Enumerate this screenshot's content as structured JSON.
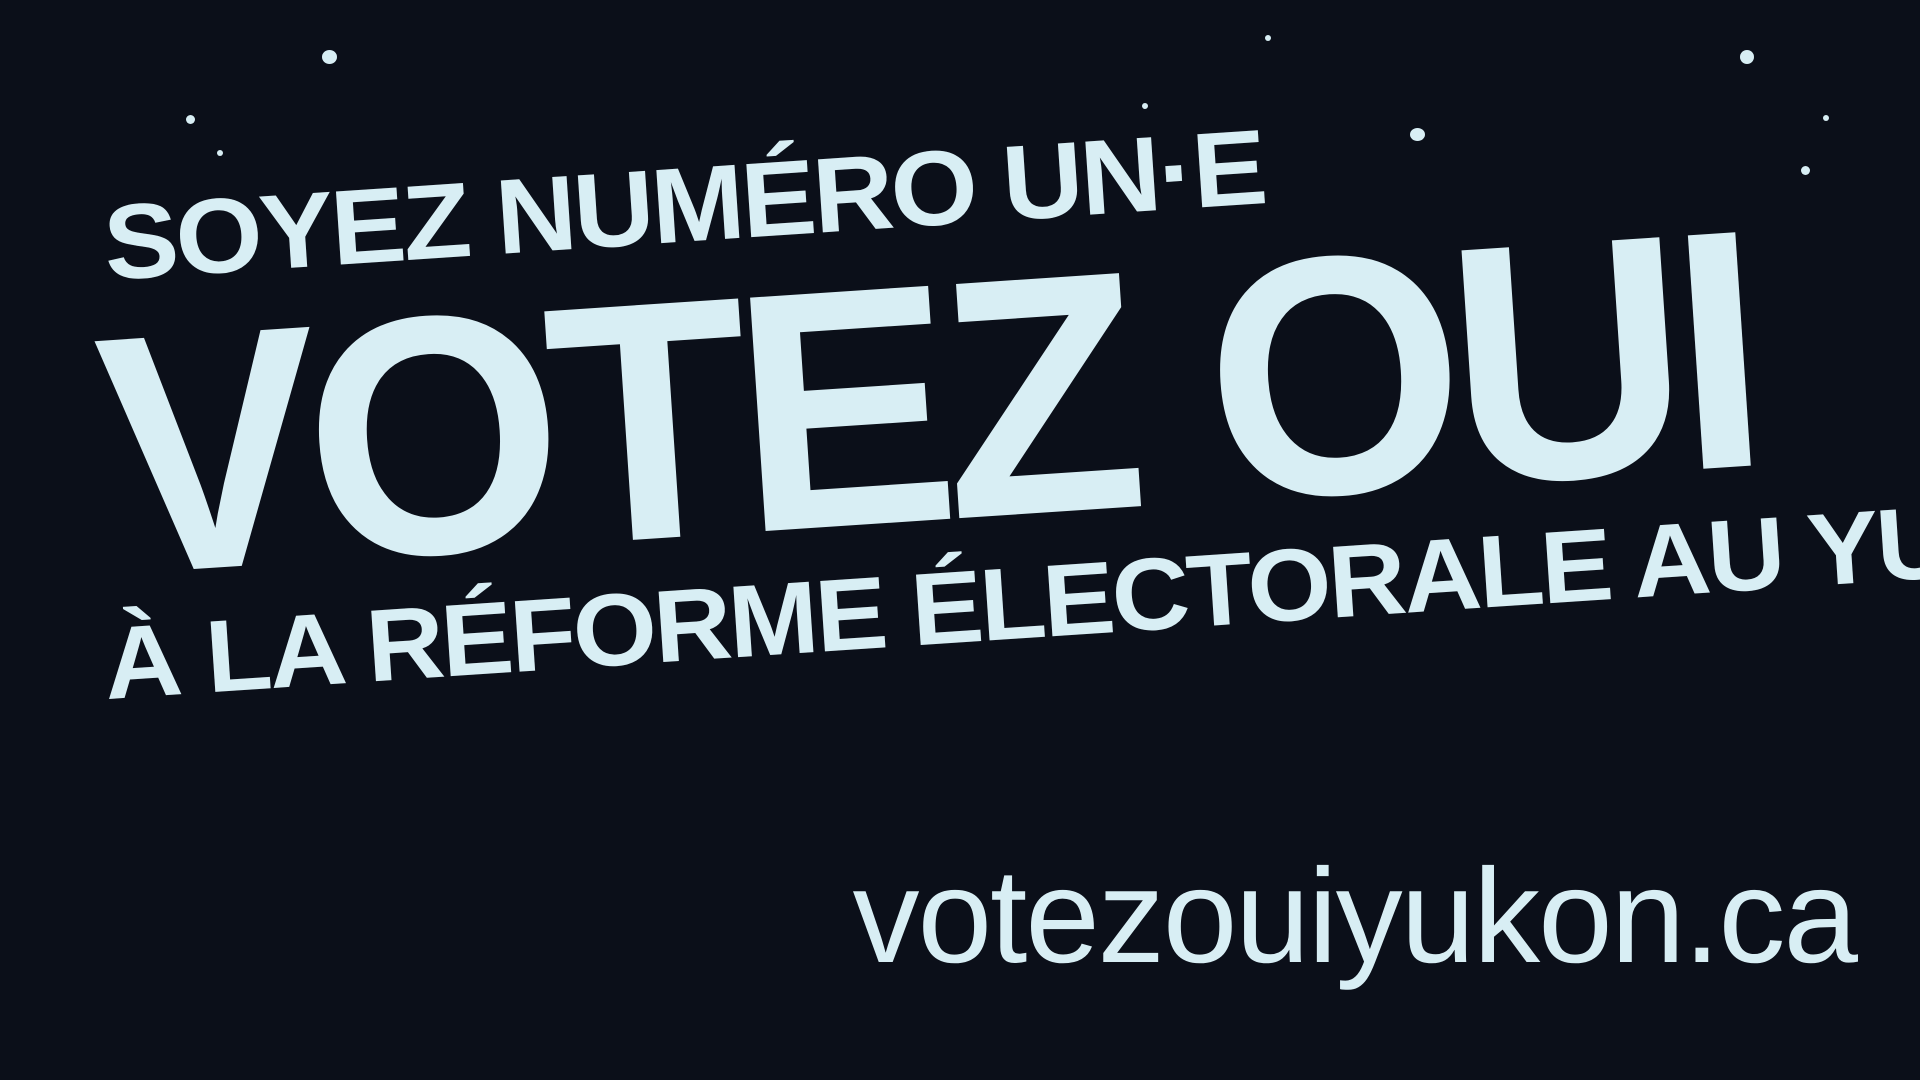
{
  "poster": {
    "line_top": "SOYEZ NUMÉRO UN·E",
    "line_main": "VOTEZ OUI",
    "line_bottom": "À LA RÉFORME ÉLECTORALE AU YUKON",
    "url": "votezouiyukon.ca"
  },
  "colors": {
    "background": "#0b0f19",
    "text": "#d8eef4"
  }
}
